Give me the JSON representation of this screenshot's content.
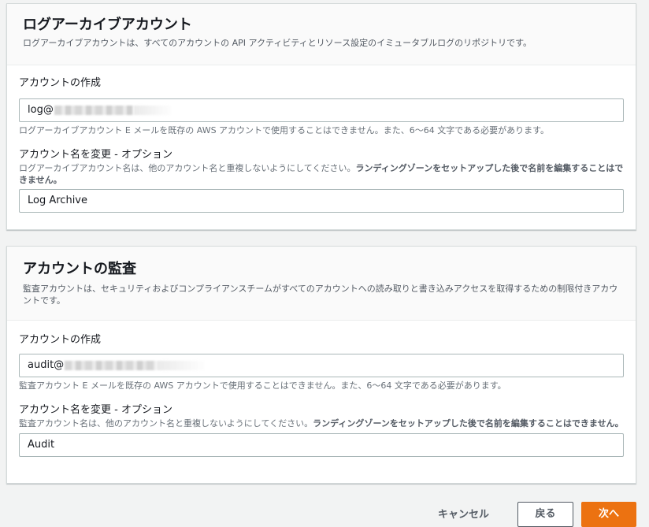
{
  "log_archive": {
    "title": "ログアーカイブアカウント",
    "description": "ログアーカイブアカウントは、すべてのアカウントの API アクティビティとリソース設定のイミュータブルログのリポジトリです。",
    "email": {
      "label": "アカウントの作成",
      "value_prefix": "log@",
      "hint": "ログアーカイブアカウント E メールを既存の AWS アカウントで使用することはできません。また、6〜64 文字である必要があります。"
    },
    "rename": {
      "label": "アカウント名を変更 - オプション",
      "hint": "ログアーカイブアカウント名は、他のアカウント名と重複しないようにしてください。",
      "hint_bold": "ランディングゾーンをセットアップした後で名前を編集することはできません。",
      "value": "Log Archive"
    }
  },
  "audit": {
    "title": "アカウントの監査",
    "description": "監査アカウントは、セキュリティおよびコンプライアンスチームがすべてのアカウントへの読み取りと書き込みアクセスを取得するための制限付きアカウントです。",
    "email": {
      "label": "アカウントの作成",
      "value_prefix": "audit@",
      "hint": "監査アカウント E メールを既存の AWS アカウントで使用することはできません。また、6〜64 文字である必要があります。"
    },
    "rename": {
      "label": "アカウント名を変更 - オプション",
      "hint": "監査アカウント名は、他のアカウント名と重複しないようにしてください。",
      "hint_bold": "ランディングゾーンをセットアップした後で名前を編集することはできません。",
      "value": "Audit"
    }
  },
  "actions": {
    "cancel": "キャンセル",
    "back": "戻る",
    "next": "次へ"
  },
  "colors": {
    "primary": "#ec7211",
    "page_bg": "#f2f3f3",
    "border": "#aab7b8"
  }
}
